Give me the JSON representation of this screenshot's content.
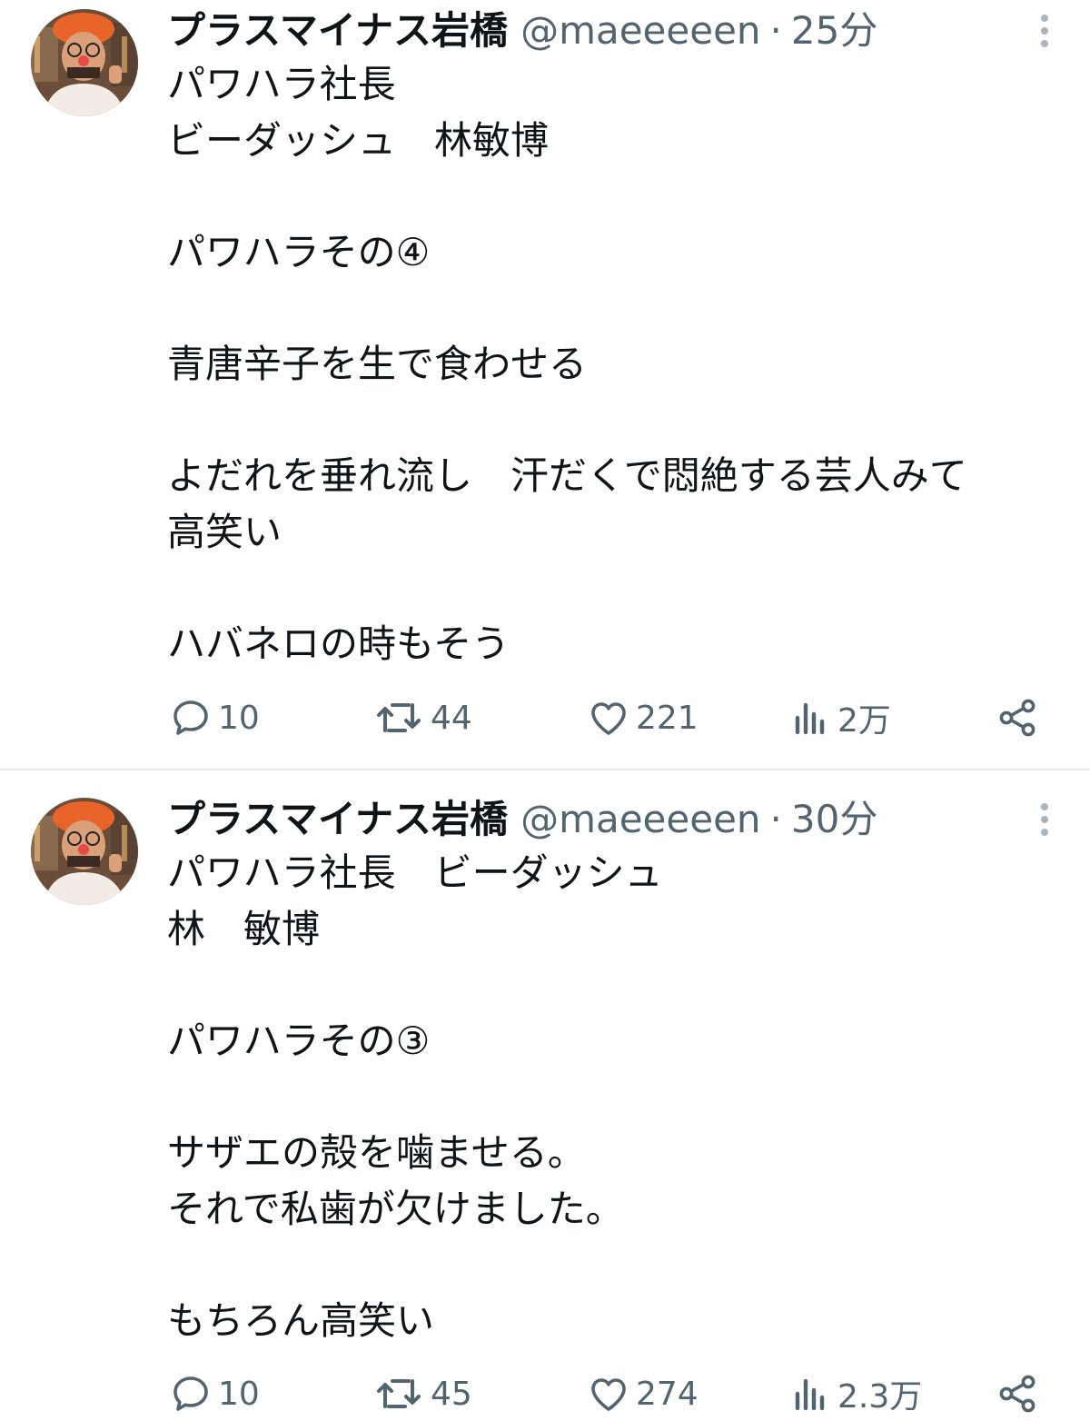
{
  "tweets": [
    {
      "name": "プラスマイナス岩橋",
      "handle": "@maeeeeen",
      "dot": "·",
      "time": "25分",
      "lines": [
        "パワハラ社長",
        "ビーダッシュ　林敏博",
        "",
        "パワハラその④",
        "",
        "青唐辛子を生で食わせる",
        "",
        "よだれを垂れ流し　汗だくで悶絶する芸人みて",
        "高笑い",
        "",
        "ハバネロの時もそう"
      ],
      "replies": "10",
      "reposts": "44",
      "likes": "221",
      "views": "2万"
    },
    {
      "name": "プラスマイナス岩橋",
      "handle": "@maeeeeen",
      "dot": "·",
      "time": "30分",
      "lines": [
        "パワハラ社長　ビーダッシュ",
        "林　敏博",
        "",
        "パワハラその③",
        "",
        "サザエの殻を噛ませる。",
        "それで私歯が欠けました。",
        "",
        "もちろん高笑い"
      ],
      "replies": "10",
      "reposts": "45",
      "likes": "274",
      "views": "2.3万"
    }
  ],
  "colors": {
    "text": "#0f1419",
    "secondary": "#536471",
    "divider": "#e7e9ea"
  },
  "icons": [
    "reply-icon",
    "repost-icon",
    "like-icon",
    "views-icon",
    "share-icon",
    "more-icon"
  ]
}
